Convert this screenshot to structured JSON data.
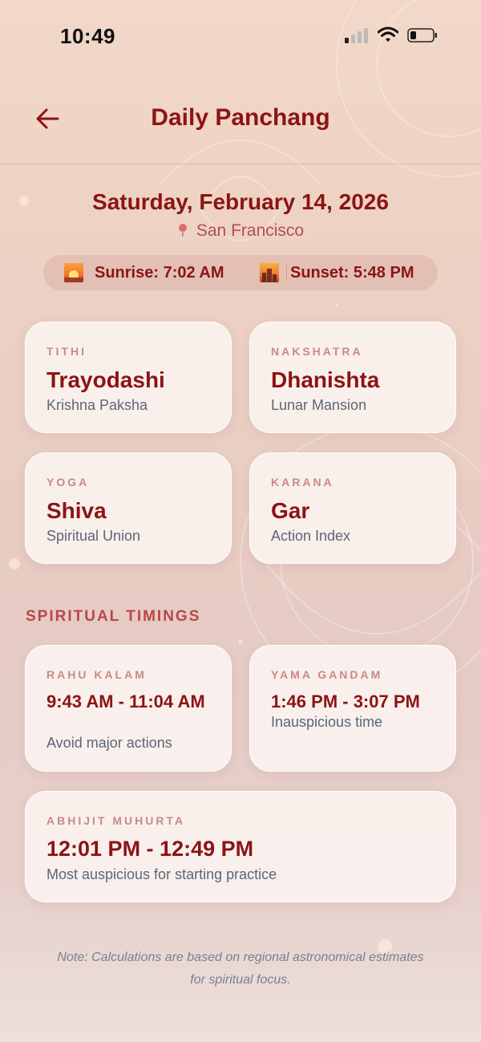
{
  "status_bar": {
    "time": "10:49"
  },
  "header": {
    "title": "Daily Panchang"
  },
  "date": "Saturday, February 14, 2026",
  "location": "San Francisco",
  "sun": {
    "sunrise": "Sunrise: 7:02 AM",
    "sunset": "Sunset: 5:48 PM"
  },
  "panchang": [
    {
      "label": "TITHI",
      "value": "Trayodashi",
      "sub": "Krishna Paksha"
    },
    {
      "label": "NAKSHATRA",
      "value": "Dhanishta",
      "sub": "Lunar Mansion"
    },
    {
      "label": "YOGA",
      "value": "Shiva",
      "sub": "Spiritual Union"
    },
    {
      "label": "KARANA",
      "value": "Gar",
      "sub": "Action Index"
    }
  ],
  "timings_title": "SPIRITUAL TIMINGS",
  "timings": [
    {
      "label": "RAHU KALAM",
      "value": "9:43 AM - 11:04 AM",
      "sub": "Avoid major actions"
    },
    {
      "label": "YAMA GANDAM",
      "value": "1:46 PM - 3:07 PM",
      "sub": "Inauspicious time"
    },
    {
      "label": "ABHIJIT MUHURTA",
      "value": "12:01 PM - 12:49 PM",
      "sub": "Most auspicious for starting practice"
    }
  ],
  "note": "Note: Calculations are based on regional astronomical estimates for spiritual focus.",
  "colors": {
    "accent": "#8b1414",
    "label": "#c88a88",
    "sub": "#5d6677"
  }
}
